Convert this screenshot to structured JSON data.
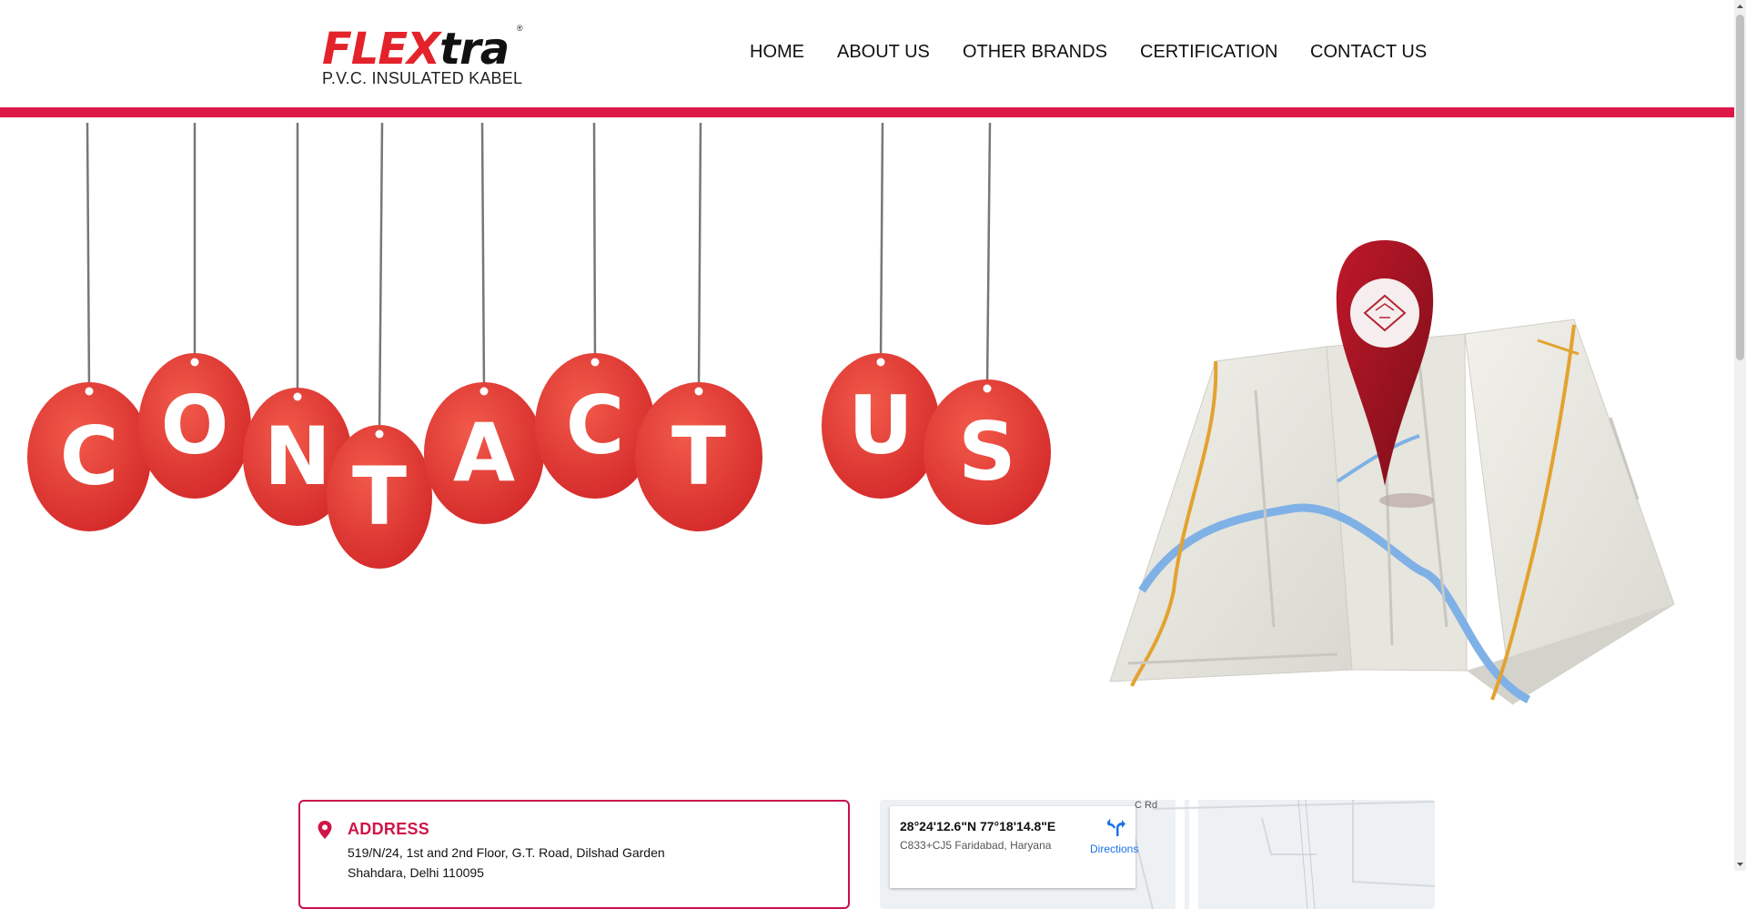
{
  "brand": {
    "name_part1": "FLEX",
    "name_part2": "tra",
    "registered": "®",
    "tagline": "P.V.C. INSULATED KABEL",
    "accent_color": "#dd1848",
    "logo_red": "#e4222b"
  },
  "nav": {
    "items": [
      {
        "label": "HOME"
      },
      {
        "label": "ABOUT US"
      },
      {
        "label": "OTHER BRANDS"
      },
      {
        "label": "CERTIFICATION"
      },
      {
        "label": "CONTACT US"
      }
    ]
  },
  "hero": {
    "letters": [
      "C",
      "O",
      "N",
      "T",
      "A",
      "C",
      "T",
      "U",
      "S"
    ],
    "tag_color": "#e2332f",
    "pin_color": "#a0131f",
    "map_icon": "location-pin-icon"
  },
  "address": {
    "icon": "map-marker-icon",
    "title": "ADDRESS",
    "line1": "519/N/24, 1st and 2nd Floor, G.T. Road, Dilshad Garden",
    "line2": "Shahdara, Delhi 110095"
  },
  "map": {
    "coords": "28°24'12.6\"N 77°18'14.8\"E",
    "place": "C833+CJ5 Faridabad, Haryana",
    "directions_label": "Directions",
    "road_label": "C Rd"
  }
}
